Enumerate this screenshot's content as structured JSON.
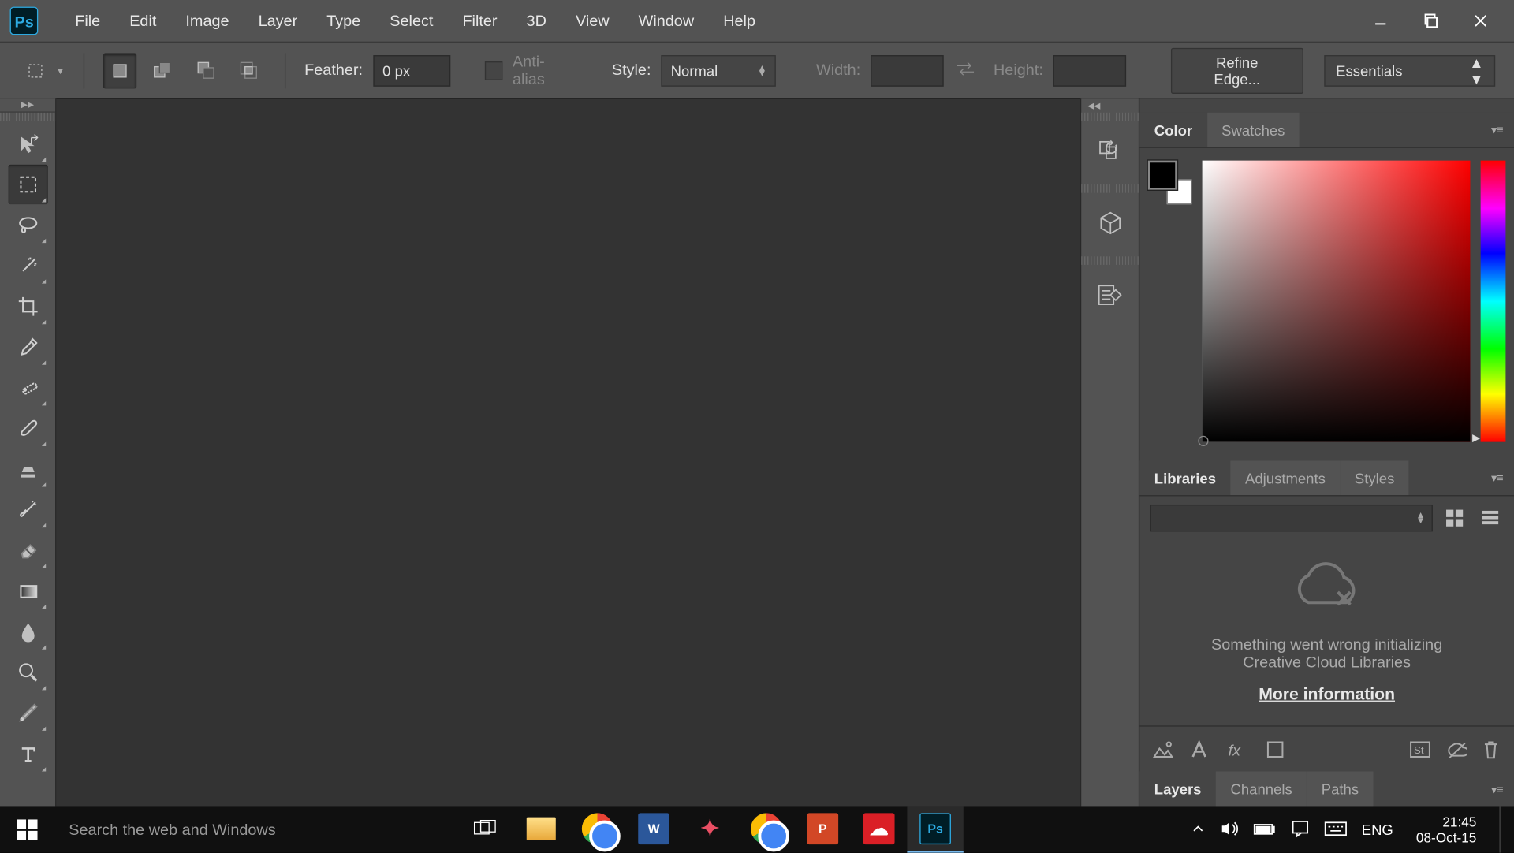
{
  "menu": {
    "items": [
      "File",
      "Edit",
      "Image",
      "Layer",
      "Type",
      "Select",
      "Filter",
      "3D",
      "View",
      "Window",
      "Help"
    ]
  },
  "options": {
    "feather_label": "Feather:",
    "feather_value": "0 px",
    "antialias_label": "Anti-alias",
    "style_label": "Style:",
    "style_value": "Normal",
    "width_label": "Width:",
    "height_label": "Height:",
    "refine_label": "Refine Edge...",
    "workspace": "Essentials"
  },
  "panels": {
    "color_tab": "Color",
    "swatches_tab": "Swatches",
    "libraries_tab": "Libraries",
    "adjustments_tab": "Adjustments",
    "styles_tab": "Styles",
    "lib_error_l1": "Something went wrong initializing",
    "lib_error_l2": "Creative Cloud Libraries",
    "lib_link": "More information",
    "layers_tab": "Layers",
    "channels_tab": "Channels",
    "paths_tab": "Paths"
  },
  "taskbar": {
    "search_placeholder": "Search the web and Windows",
    "lang": "ENG",
    "time": "21:45",
    "date": "08-Oct-15"
  }
}
